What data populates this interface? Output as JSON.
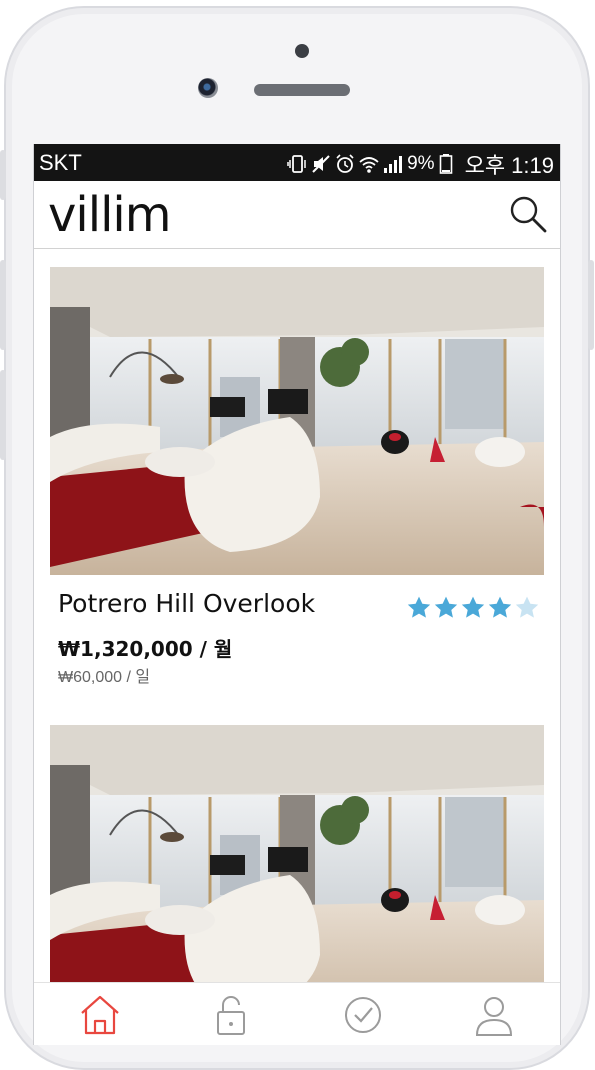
{
  "status_bar": {
    "carrier": "SKT",
    "battery": "9%",
    "time": "오후 1:19",
    "icons": [
      "vibrate-icon",
      "mute-icon",
      "alarm-icon",
      "wifi-icon",
      "signal-icon",
      "battery-icon"
    ]
  },
  "header": {
    "logo": "villim",
    "search_icon": "search-icon"
  },
  "listings": [
    {
      "title": "Potrero Hill Overlook",
      "rating": 4,
      "rating_max": 5,
      "price_month": "₩1,320,000 / 월",
      "price_day": "₩60,000 / 일"
    },
    {
      "title": "",
      "rating": 0,
      "price_month": "",
      "price_day": ""
    }
  ],
  "tab_bar": {
    "items": [
      {
        "icon": "home-icon",
        "active": true
      },
      {
        "icon": "lock-icon",
        "active": false
      },
      {
        "icon": "check-circle-icon",
        "active": false
      },
      {
        "icon": "user-icon",
        "active": false
      }
    ],
    "active_color": "#e8473f",
    "inactive_color": "#9b9b9b"
  },
  "colors": {
    "star_filled": "#4aa8d8",
    "star_empty": "#c8e3f2",
    "statusbar_bg": "#141414"
  }
}
